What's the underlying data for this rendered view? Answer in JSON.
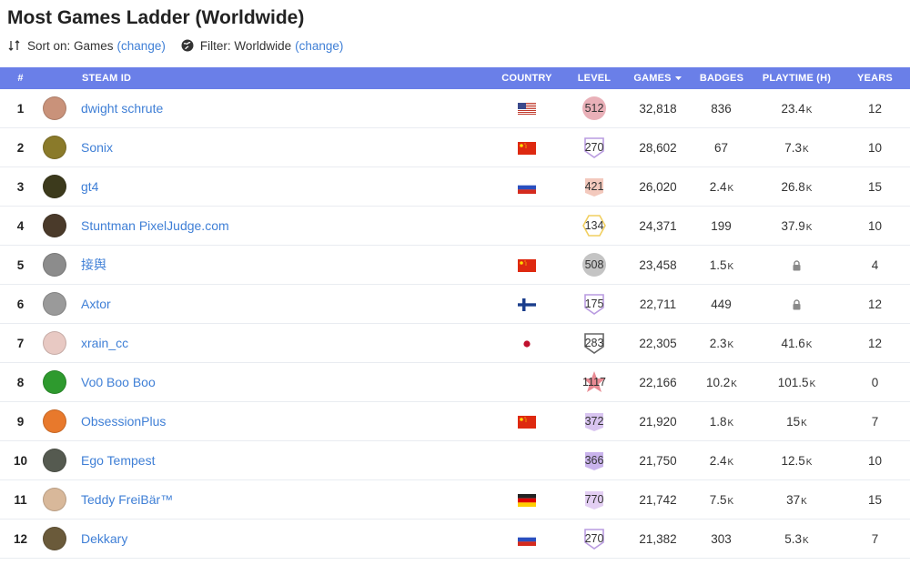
{
  "header": {
    "title": "Most Games Ladder (Worldwide)",
    "sort_label": "Sort on: Games",
    "sort_change": "(change)",
    "filter_label": "Filter: Worldwide",
    "filter_change": "(change)"
  },
  "columns": {
    "rank": "#",
    "steam_id": "STEAM ID",
    "country": "COUNTRY",
    "level": "LEVEL",
    "games": "GAMES",
    "badges": "BADGES",
    "playtime": "PLAYTIME (H)",
    "years": "YEARS"
  },
  "colors": {
    "accent": "#6a7fe8",
    "link": "#3f7fd6"
  },
  "rows": [
    {
      "rank": "1",
      "name": "dwight schrute",
      "country": "us",
      "level": "512",
      "level_style": "circle",
      "level_color": "#e9b0b8",
      "games": "32,818",
      "badges": "836",
      "badges_k": "",
      "playtime": "23.4",
      "playtime_k": "K",
      "years": "12",
      "avatar": "#c9927a"
    },
    {
      "rank": "2",
      "name": "Sonix",
      "country": "cn",
      "level": "270",
      "level_style": "shield",
      "level_color": "#b99be0",
      "games": "28,602",
      "badges": "67",
      "badges_k": "",
      "playtime": "7.3",
      "playtime_k": "K",
      "years": "10",
      "avatar": "#8a7a2a"
    },
    {
      "rank": "3",
      "name": "gt4",
      "country": "ru",
      "level": "421",
      "level_style": "square",
      "level_color": "#f3c9bd",
      "games": "26,020",
      "badges": "2.4",
      "badges_k": "K",
      "playtime": "26.8",
      "playtime_k": "K",
      "years": "15",
      "avatar": "#3c3a1c"
    },
    {
      "rank": "4",
      "name": "Stuntman PixelJudge.com",
      "country": "",
      "level": "134",
      "level_style": "hex",
      "level_color": "#f1cf60",
      "games": "24,371",
      "badges": "199",
      "badges_k": "",
      "playtime": "37.9",
      "playtime_k": "K",
      "years": "10",
      "avatar": "#4a3a2a"
    },
    {
      "rank": "5",
      "name": "接舆",
      "country": "cn",
      "level": "508",
      "level_style": "circle",
      "level_color": "#c4c4c4",
      "games": "23,458",
      "badges": "1.5",
      "badges_k": "K",
      "playtime": "",
      "playtime_k": "",
      "playtime_locked": "lock-icon",
      "years": "4",
      "avatar": "#8c8c8c"
    },
    {
      "rank": "6",
      "name": "Axtor",
      "country": "fi",
      "level": "175",
      "level_style": "shield",
      "level_color": "#b99be0",
      "games": "22,711",
      "badges": "449",
      "badges_k": "",
      "playtime": "",
      "playtime_k": "",
      "playtime_locked": "lock-icon",
      "years": "12",
      "avatar": "#9a9a9a"
    },
    {
      "rank": "7",
      "name": "xrain_cc",
      "country": "jp",
      "level": "283",
      "level_style": "shield",
      "level_color": "#666666",
      "games": "22,305",
      "badges": "2.3",
      "badges_k": "K",
      "playtime": "41.6",
      "playtime_k": "K",
      "years": "12",
      "avatar": "#e8c9c3"
    },
    {
      "rank": "8",
      "name": "Vo0 Boo Boo",
      "country": "",
      "level": "1117",
      "level_style": "star",
      "level_color": "#e88a93",
      "games": "22,166",
      "badges": "10.2",
      "badges_k": "K",
      "playtime": "101.5",
      "playtime_k": "K",
      "years": "0",
      "avatar": "#2e9a2e"
    },
    {
      "rank": "9",
      "name": "ObsessionPlus",
      "country": "cn",
      "level": "372",
      "level_style": "square",
      "level_color": "#d8c4f0",
      "games": "21,920",
      "badges": "1.8",
      "badges_k": "K",
      "playtime": "15",
      "playtime_k": "K",
      "years": "7",
      "avatar": "#e8792c"
    },
    {
      "rank": "10",
      "name": "Ego Tempest",
      "country": "",
      "level": "366",
      "level_style": "square",
      "level_color": "#c9b3ec",
      "games": "21,750",
      "badges": "2.4",
      "badges_k": "K",
      "playtime": "12.5",
      "playtime_k": "K",
      "years": "10",
      "avatar": "#555a50"
    },
    {
      "rank": "11",
      "name": "Teddy FreiBär™",
      "country": "de",
      "level": "770",
      "level_style": "square",
      "level_color": "#e3cff3",
      "games": "21,742",
      "badges": "7.5",
      "badges_k": "K",
      "playtime": "37",
      "playtime_k": "K",
      "years": "15",
      "avatar": "#d8b89a"
    },
    {
      "rank": "12",
      "name": "Dekkary",
      "country": "ru",
      "level": "270",
      "level_style": "shield",
      "level_color": "#b99be0",
      "games": "21,382",
      "badges": "303",
      "badges_k": "",
      "playtime": "5.3",
      "playtime_k": "K",
      "years": "7",
      "avatar": "#6a5a3a"
    }
  ]
}
